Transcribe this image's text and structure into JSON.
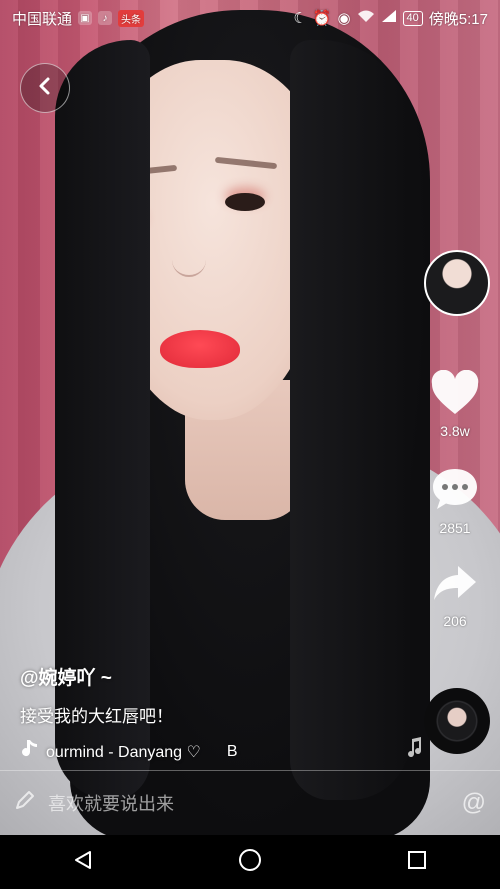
{
  "status_bar": {
    "carrier": "中国联通",
    "app_badge": "头条",
    "battery": "40",
    "time": "傍晚5:17"
  },
  "post": {
    "username": "@婉婷吖 ~",
    "caption": "接受我的大红唇吧！",
    "music": "ourmind - Danyang ♡",
    "music_trailing": "B"
  },
  "actions": {
    "likes": "3.8w",
    "comments": "2851",
    "shares": "206"
  },
  "comment_bar": {
    "placeholder": "喜欢就要说出来",
    "at_symbol": "@"
  },
  "icons": {
    "back": "chevron-left-icon",
    "like": "heart-icon",
    "comment": "comment-bubble-icon",
    "share": "share-arrow-icon",
    "music": "music-note-icon",
    "edit": "pencil-icon",
    "nav_back": "triangle-back-icon",
    "nav_home": "circle-home-icon",
    "nav_recent": "square-recent-icon"
  },
  "colors": {
    "accent": "#fe2c55",
    "lips": "#ff4a55"
  }
}
